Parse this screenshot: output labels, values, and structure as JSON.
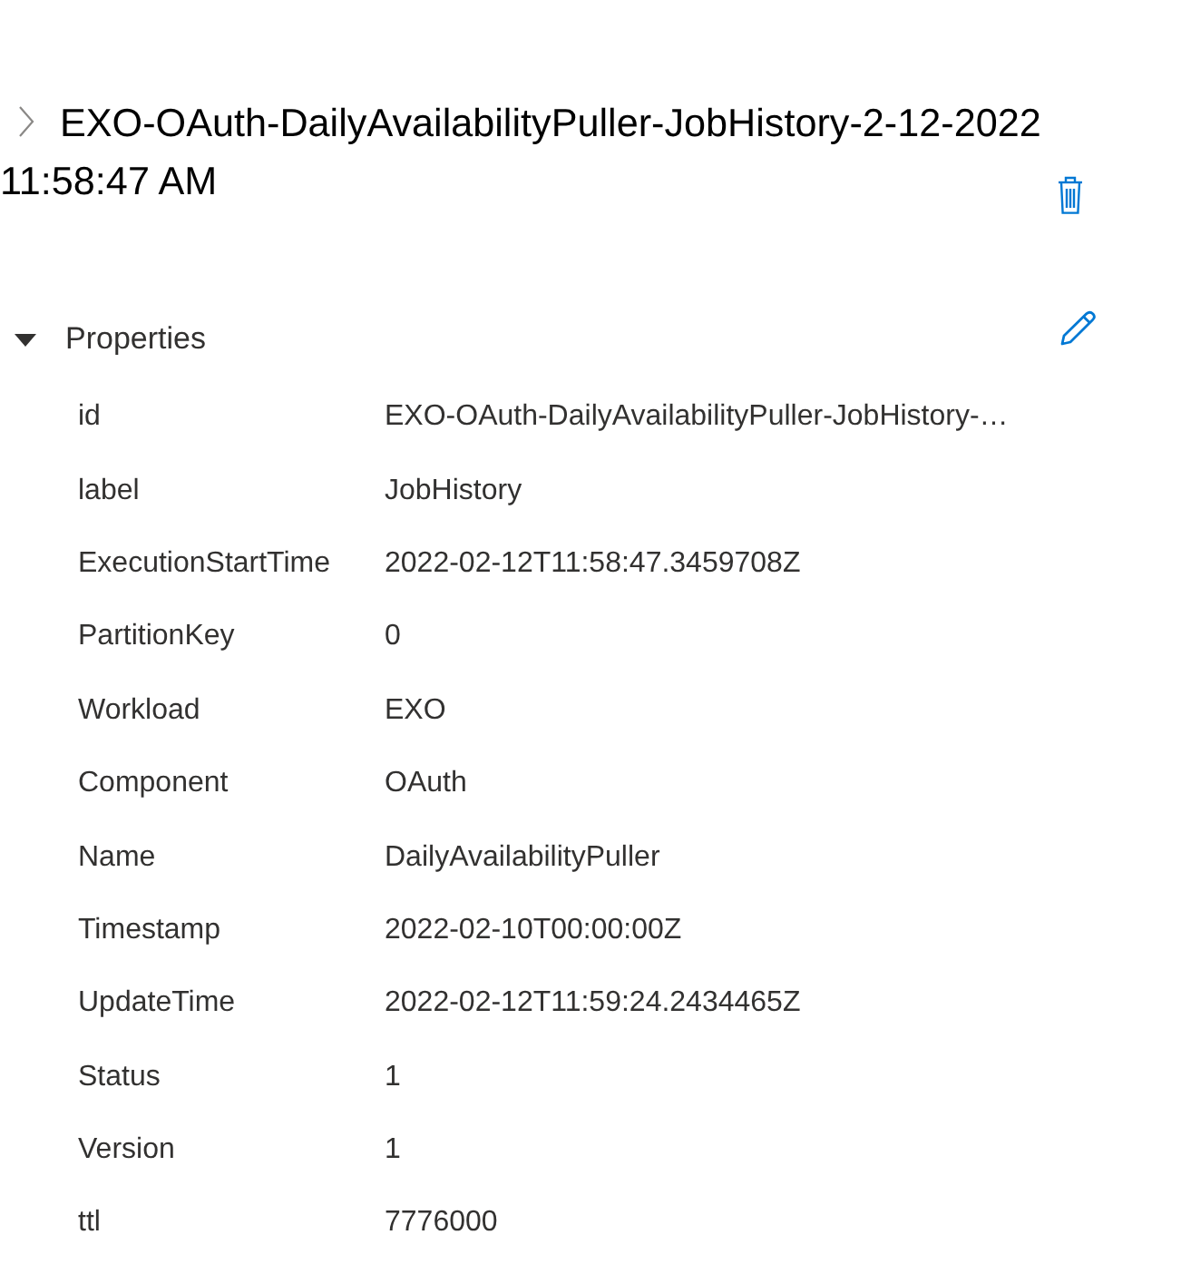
{
  "title": {
    "text": "EXO-OAuth-DailyAvailabilityPuller-JobHistory-2-12-2022 11:58:47 AM"
  },
  "section": {
    "label": "Properties",
    "expanded": true,
    "properties": [
      {
        "key": "id",
        "value": "EXO-OAuth-DailyAvailabilityPuller-JobHistory-…"
      },
      {
        "key": "label",
        "value": "JobHistory"
      },
      {
        "key": "ExecutionStartTime",
        "value": "2022-02-12T11:58:47.3459708Z"
      },
      {
        "key": "PartitionKey",
        "value": "0"
      },
      {
        "key": "Workload",
        "value": "EXO"
      },
      {
        "key": "Component",
        "value": "OAuth"
      },
      {
        "key": "Name",
        "value": "DailyAvailabilityPuller"
      },
      {
        "key": "Timestamp",
        "value": "2022-02-10T00:00:00Z"
      },
      {
        "key": "UpdateTime",
        "value": "2022-02-12T11:59:24.2434465Z"
      },
      {
        "key": "Status",
        "value": "1"
      },
      {
        "key": "Version",
        "value": "1"
      },
      {
        "key": "ttl",
        "value": "7776000"
      }
    ]
  }
}
